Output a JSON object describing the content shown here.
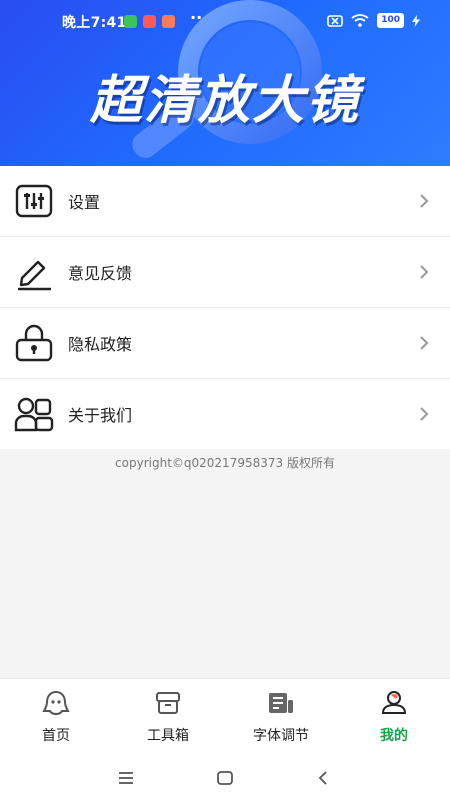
{
  "status_bar": {
    "time": "晚上7:41",
    "more": "··",
    "battery": "100"
  },
  "banner": {
    "title": "超清放大镜"
  },
  "menu": {
    "items": [
      {
        "label": "设置",
        "icon": "sliders-icon"
      },
      {
        "label": "意见反馈",
        "icon": "pen-icon"
      },
      {
        "label": "隐私政策",
        "icon": "lock-icon"
      },
      {
        "label": "关于我们",
        "icon": "users-icon"
      }
    ]
  },
  "copyright": "copyright©q020217958373 版权所有",
  "tabs": [
    {
      "label": "首页",
      "icon": "home-icon",
      "active": false
    },
    {
      "label": "工具箱",
      "icon": "toolbox-icon",
      "active": false
    },
    {
      "label": "字体调节",
      "icon": "font-size-icon",
      "active": false
    },
    {
      "label": "我的",
      "icon": "profile-icon",
      "active": true
    }
  ],
  "colors": {
    "banner_blue": "#2a4cf0",
    "active_tab": "#1aa34a"
  }
}
